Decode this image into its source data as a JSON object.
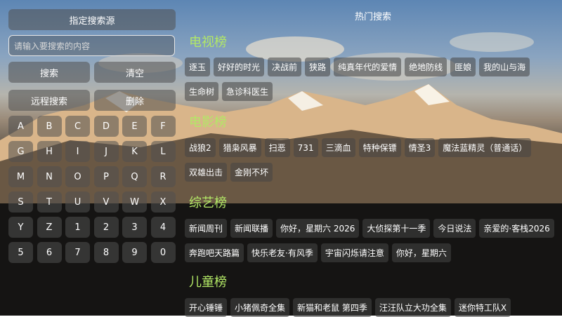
{
  "left": {
    "source_button": "指定搜索源",
    "search_placeholder": "请输入要搜索的内容",
    "search_button": "搜索",
    "clear_button": "清空",
    "remote_button": "远程搜索",
    "delete_button": "删除",
    "keys": [
      "A",
      "B",
      "C",
      "D",
      "E",
      "F",
      "G",
      "H",
      "I",
      "J",
      "K",
      "L",
      "M",
      "N",
      "O",
      "P",
      "Q",
      "R",
      "S",
      "T",
      "U",
      "V",
      "W",
      "X",
      "Y",
      "Z",
      "1",
      "2",
      "3",
      "4",
      "5",
      "6",
      "7",
      "8",
      "9",
      "0"
    ]
  },
  "hot": {
    "title": "热门搜索",
    "sections": [
      {
        "name": "电视榜",
        "rows": [
          [
            "逐玉",
            "好好的时光",
            "决战前",
            "狭路",
            "纯真年代的爱情",
            "绝地防线",
            "匪娘",
            "我的山与海"
          ],
          [
            "生命树",
            "急诊科医生"
          ]
        ]
      },
      {
        "name": "电影榜",
        "rows": [
          [
            "战狼2",
            "猎枭风暴",
            "扫恶",
            "731",
            "三滴血",
            "特种保镖",
            "情圣3",
            "魔法蓝精灵（普通话）"
          ],
          [
            "双雄出击",
            "金刚不坏"
          ]
        ]
      },
      {
        "name": "综艺榜",
        "rows": [
          [
            "新闻周刊",
            "新闻联播",
            "你好，星期六 2026",
            "大侦探第十一季",
            "今日说法",
            "亲爱的·客栈2026"
          ],
          [
            "奔跑吧天路篇",
            "快乐老友·有风季",
            "宇宙闪烁请注意",
            "你好，星期六"
          ]
        ]
      },
      {
        "name": "儿童榜",
        "rows": [
          [
            "开心锤锤",
            "小猪佩奇全集",
            "新猫和老鼠 第四季",
            "汪汪队立大功全集",
            "迷你特工队X"
          ]
        ]
      }
    ]
  }
}
